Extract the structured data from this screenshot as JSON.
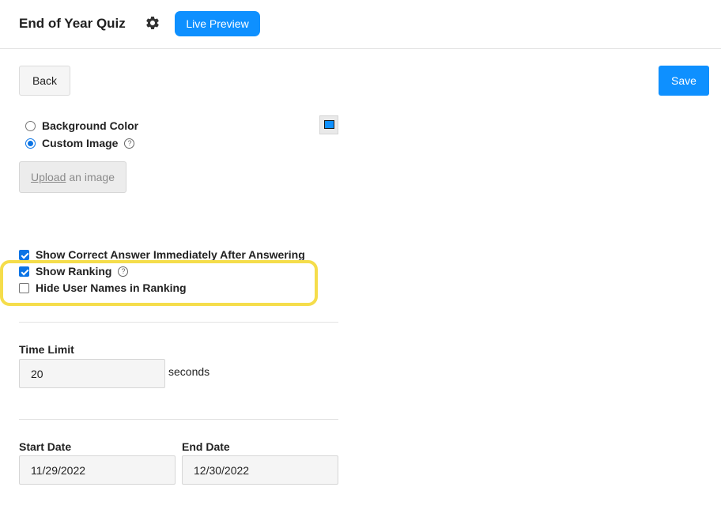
{
  "header": {
    "title": "End of Year Quiz",
    "settings_icon": "gear-icon",
    "live_preview_label": "Live Preview"
  },
  "toolbar": {
    "back_label": "Back",
    "save_label": "Save"
  },
  "background": {
    "options": [
      {
        "label": "Background Color",
        "selected": false
      },
      {
        "label": "Custom Image",
        "selected": true,
        "help_icon": "question-circle-icon"
      }
    ],
    "color_swatch": "#0e90ff",
    "upload": {
      "link_text": "Upload",
      "rest_text": "an image"
    }
  },
  "options": {
    "show_correct_answer": {
      "label": "Show Correct Answer Immediately After Answering",
      "checked": true
    },
    "show_ranking": {
      "label": "Show Ranking",
      "checked": true,
      "help_icon": "question-circle-icon"
    },
    "hide_user_names": {
      "label": "Hide User Names in Ranking",
      "checked": false
    }
  },
  "time_limit": {
    "label": "Time Limit",
    "value": "20",
    "unit": "seconds"
  },
  "dates": {
    "start_label": "Start Date",
    "start_value": "11/29/2022",
    "end_label": "End Date",
    "end_value": "12/30/2022"
  },
  "colors": {
    "accent": "#0e90ff",
    "highlight": "#f5dd4b"
  }
}
